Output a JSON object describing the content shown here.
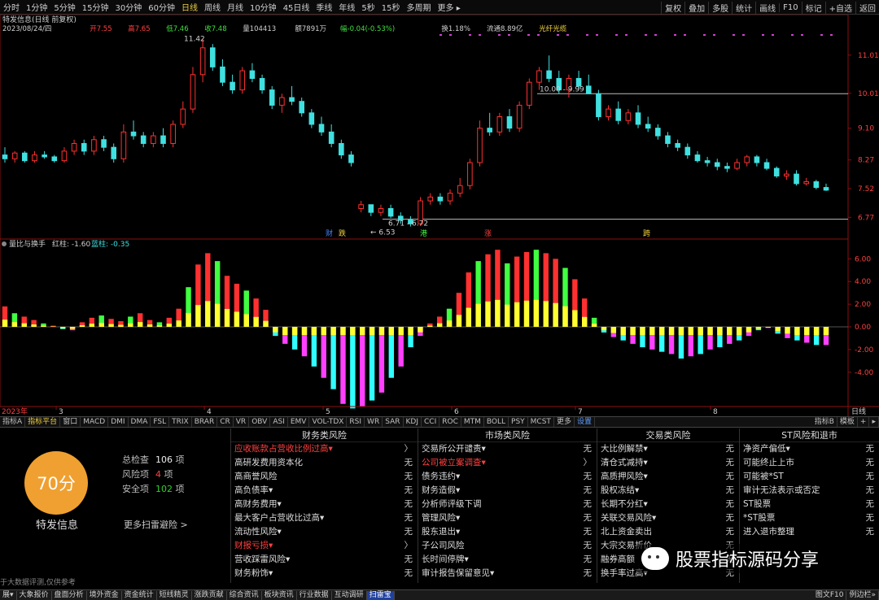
{
  "period_bar": {
    "items": [
      "分时",
      "1分钟",
      "5分钟",
      "15分钟",
      "30分钟",
      "60分钟",
      "日线",
      "周线",
      "月线",
      "10分钟",
      "45日线",
      "季线",
      "年线",
      "5秒",
      "15秒",
      "多周期",
      "更多 ▸"
    ],
    "active": "日线",
    "right": [
      "复权",
      "叠加",
      "多股",
      "统计",
      "画线",
      "F10",
      "标记",
      "+自选",
      "返回"
    ]
  },
  "stock_header": {
    "title": "特发信息(日线 前复权)",
    "date": "2023/08/24/四",
    "open": "开7.55",
    "high": "高7.65",
    "low": "低7.46",
    "close": "收7.48",
    "volume": "量104413",
    "amount": "额7891万",
    "change": "幅-0.04(-0.53%)",
    "turnover": "换1.18%",
    "float_value": "流通8.89亿",
    "concept": "光纤光缆"
  },
  "price_axis": [
    "11.01",
    "10.01",
    "9.10",
    "8.27",
    "7.52",
    "6.77"
  ],
  "price_annotations": {
    "high": "11.42",
    "mid_line": "10.00 - 9.99",
    "low": "6.71 - 6.72",
    "low_arrow": "← 6.53"
  },
  "signal_marks": [
    "财",
    "跌",
    "港",
    "涨",
    "跨"
  ],
  "indicator": {
    "name": "量比与换手",
    "red_label": "红柱: -1.60",
    "blue_label": "蓝柱: -0.35",
    "axis": [
      "6.00",
      "4.00",
      "2.00",
      "0.00",
      "-2.00",
      "-4.00"
    ]
  },
  "time_axis": [
    "2023年",
    "3",
    "4",
    "5",
    "6",
    "7",
    "8",
    "日线"
  ],
  "tab_bar": {
    "tabs": [
      "指标A",
      "指标平台",
      "窗口",
      "MACD",
      "DMI",
      "DMA",
      "FSL",
      "TRIX",
      "BRAR",
      "CR",
      "VR",
      "OBV",
      "ASI",
      "EMV",
      "VOL-TDX",
      "RSI",
      "WR",
      "SAR",
      "KDJ",
      "CCI",
      "ROC",
      "MTM",
      "BOLL",
      "PSY",
      "MCST",
      "更多",
      "设置"
    ],
    "right": [
      "指标B",
      "模板",
      "+",
      "▸"
    ]
  },
  "risk_panel": {
    "score": "70分",
    "company": "特发信息",
    "stats": [
      {
        "label": "总检查",
        "value": "106",
        "unit": "项"
      },
      {
        "label": "风险项",
        "value": "4",
        "unit": "项"
      },
      {
        "label": "安全项",
        "value": "102",
        "unit": "项"
      }
    ],
    "more": "更多扫雷避险 >",
    "disclaimer": "于大数据评测,仅供参考",
    "columns": [
      {
        "title": "财务类风险",
        "rows": [
          {
            "label": "应收账款占营收比例过高▾",
            "value": "〉",
            "risk": true
          },
          {
            "label": "高研发费用资本化",
            "value": "无",
            "risk": false
          },
          {
            "label": "高商誉风险",
            "value": "无",
            "risk": false
          },
          {
            "label": "高负债率▾",
            "value": "无",
            "risk": false
          },
          {
            "label": "高财务费用▾",
            "value": "无",
            "risk": false
          },
          {
            "label": "最大客户占营收比过高▾",
            "value": "无",
            "risk": false
          },
          {
            "label": "流动性风险▾",
            "value": "无",
            "risk": false
          },
          {
            "label": "财报亏损▾",
            "value": "〉",
            "risk": true
          },
          {
            "label": "营收踩雷风险▾",
            "value": "无",
            "risk": false
          },
          {
            "label": "财务粉饰▾",
            "value": "无",
            "risk": false
          }
        ]
      },
      {
        "title": "市场类风险",
        "rows": [
          {
            "label": "交易所公开谴责▾",
            "value": "无",
            "risk": false
          },
          {
            "label": "公司被立案调查▾",
            "value": "〉",
            "risk": true
          },
          {
            "label": "债务违约▾",
            "value": "无",
            "risk": false
          },
          {
            "label": "财务造假▾",
            "value": "无",
            "risk": false
          },
          {
            "label": "分析师评级下调",
            "value": "无",
            "risk": false
          },
          {
            "label": "管理风险▾",
            "value": "无",
            "risk": false
          },
          {
            "label": "股东退出▾",
            "value": "无",
            "risk": false
          },
          {
            "label": "子公司风险",
            "value": "无",
            "risk": false
          },
          {
            "label": "长时间停牌▾",
            "value": "无",
            "risk": false
          },
          {
            "label": "审计报告保留意见▾",
            "value": "无",
            "risk": false
          }
        ]
      },
      {
        "title": "交易类风险",
        "rows": [
          {
            "label": "大比例解禁▾",
            "value": "无",
            "risk": false
          },
          {
            "label": "清仓式减持▾",
            "value": "无",
            "risk": false
          },
          {
            "label": "高质押风险▾",
            "value": "无",
            "risk": false
          },
          {
            "label": "股权冻结▾",
            "value": "无",
            "risk": false
          },
          {
            "label": "长期不分红▾",
            "value": "无",
            "risk": false
          },
          {
            "label": "关联交易风险▾",
            "value": "无",
            "risk": false
          },
          {
            "label": "北上资金卖出",
            "value": "无",
            "risk": false
          },
          {
            "label": "大宗交易折价",
            "value": "无",
            "risk": false
          },
          {
            "label": "融券高额",
            "value": "无",
            "risk": false
          },
          {
            "label": "换手率过高▾",
            "value": "无",
            "risk": false
          }
        ]
      },
      {
        "title": "ST风险和退市",
        "rows": [
          {
            "label": "净资产偏低▾",
            "value": "无",
            "risk": false
          },
          {
            "label": "可能终止上市",
            "value": "无",
            "risk": false
          },
          {
            "label": "可能被*ST",
            "value": "无",
            "risk": false
          },
          {
            "label": "审计无法表示或否定",
            "value": "无",
            "risk": false
          },
          {
            "label": "ST股票",
            "value": "无",
            "risk": false
          },
          {
            "label": "*ST股票",
            "value": "无",
            "risk": false
          },
          {
            "label": "进入退市整理",
            "value": "无",
            "risk": false
          }
        ]
      }
    ]
  },
  "watermark": "股票指标源码分享",
  "status_bar": {
    "items": [
      "展▾",
      "大象报价",
      "盘面分析",
      "境外资金",
      "资金统计",
      "短线精灵",
      "涨跌贡献",
      "综合资讯",
      "板块资讯",
      "行业数据",
      "互动调研",
      "扫雷宝"
    ],
    "active": "扫雷宝",
    "right": [
      "图文F10",
      "例边栏»"
    ]
  },
  "colors": {
    "up": "#ff3030",
    "down": "#40e0e0",
    "yellow": "#ffff30",
    "magenta": "#ff40ff",
    "green": "#40ff40",
    "cyan": "#30ffff",
    "score_bg": "#f0a030"
  },
  "chart_data": {
    "type": "candlestick",
    "title": "特发信息(日线 前复权)",
    "x_months": [
      "2023年",
      "3",
      "4",
      "5",
      "6",
      "7",
      "8"
    ],
    "y_ticks": [
      11.01,
      10.01,
      9.1,
      8.27,
      7.52,
      6.77
    ],
    "ylim": [
      6.5,
      11.6
    ],
    "candles": [
      [
        8.4,
        8.6,
        8.2,
        8.3
      ],
      [
        8.3,
        8.5,
        8.2,
        8.45
      ],
      [
        8.45,
        8.5,
        8.2,
        8.25
      ],
      [
        8.25,
        8.5,
        8.2,
        8.4
      ],
      [
        8.4,
        8.5,
        8.3,
        8.35
      ],
      [
        8.35,
        8.4,
        8.2,
        8.25
      ],
      [
        8.25,
        8.6,
        8.2,
        8.5
      ],
      [
        8.5,
        8.8,
        8.4,
        8.7
      ],
      [
        8.7,
        8.8,
        8.4,
        8.5
      ],
      [
        8.5,
        8.9,
        8.4,
        8.8
      ],
      [
        8.8,
        8.9,
        8.5,
        8.6
      ],
      [
        8.6,
        8.7,
        8.2,
        8.3
      ],
      [
        8.3,
        9.2,
        8.2,
        9.0
      ],
      [
        9.0,
        9.3,
        8.8,
        8.9
      ],
      [
        8.9,
        9.0,
        8.6,
        8.7
      ],
      [
        8.7,
        9.0,
        8.6,
        8.9
      ],
      [
        8.9,
        9.1,
        8.6,
        8.7
      ],
      [
        8.7,
        9.3,
        8.6,
        9.2
      ],
      [
        9.2,
        9.8,
        9.1,
        9.6
      ],
      [
        9.6,
        10.7,
        9.5,
        10.5
      ],
      [
        10.5,
        11.42,
        10.3,
        11.2
      ],
      [
        11.2,
        11.3,
        10.6,
        10.7
      ],
      [
        10.7,
        10.9,
        10.2,
        10.3
      ],
      [
        10.3,
        10.5,
        10.0,
        10.1
      ],
      [
        10.1,
        10.7,
        10.0,
        10.6
      ],
      [
        10.6,
        10.8,
        10.3,
        10.4
      ],
      [
        10.4,
        10.5,
        10.0,
        10.1
      ],
      [
        10.1,
        10.2,
        9.6,
        9.7
      ],
      [
        9.7,
        10.0,
        9.5,
        9.9
      ],
      [
        9.9,
        10.2,
        9.7,
        9.8
      ],
      [
        9.8,
        9.9,
        9.4,
        9.5
      ],
      [
        9.5,
        9.6,
        9.1,
        9.2
      ],
      [
        9.2,
        9.4,
        8.9,
        9.0
      ],
      [
        9.0,
        9.2,
        8.6,
        8.7
      ],
      [
        8.7,
        8.8,
        8.3,
        8.4
      ],
      [
        8.4,
        8.5,
        8.1,
        8.2
      ],
      [
        7.0,
        7.2,
        6.9,
        7.1
      ],
      [
        7.1,
        7.1,
        6.8,
        6.9
      ],
      [
        6.9,
        7.1,
        6.8,
        7.0
      ],
      [
        7.0,
        7.1,
        6.75,
        6.8
      ],
      [
        6.8,
        6.9,
        6.6,
        6.7
      ],
      [
        6.7,
        6.8,
        6.53,
        6.6
      ],
      [
        6.6,
        7.3,
        6.55,
        7.2
      ],
      [
        7.2,
        7.4,
        7.1,
        7.3
      ],
      [
        7.3,
        7.4,
        7.1,
        7.2
      ],
      [
        7.2,
        7.5,
        7.1,
        7.4
      ],
      [
        7.4,
        7.8,
        7.3,
        7.6
      ],
      [
        7.6,
        8.3,
        7.5,
        8.2
      ],
      [
        8.2,
        9.3,
        8.1,
        9.1
      ],
      [
        9.1,
        9.5,
        8.9,
        9.0
      ],
      [
        9.0,
        9.5,
        8.9,
        9.4
      ],
      [
        9.4,
        9.6,
        9.0,
        9.1
      ],
      [
        9.1,
        9.8,
        9.0,
        9.7
      ],
      [
        9.7,
        10.4,
        9.6,
        10.3
      ],
      [
        10.3,
        10.7,
        10.1,
        10.6
      ],
      [
        10.6,
        11.0,
        10.3,
        10.4
      ],
      [
        10.4,
        10.6,
        10.0,
        10.1
      ],
      [
        10.1,
        10.5,
        9.9,
        10.4
      ],
      [
        10.4,
        10.6,
        10.1,
        10.2
      ],
      [
        10.2,
        10.5,
        9.99,
        10.0
      ],
      [
        10.0,
        10.1,
        9.3,
        9.4
      ],
      [
        9.4,
        9.7,
        9.3,
        9.6
      ],
      [
        9.6,
        9.8,
        9.2,
        9.3
      ],
      [
        9.3,
        9.6,
        9.2,
        9.5
      ],
      [
        9.5,
        9.7,
        9.1,
        9.2
      ],
      [
        9.2,
        9.4,
        9.0,
        9.1
      ],
      [
        9.1,
        9.2,
        8.8,
        8.9
      ],
      [
        8.9,
        9.0,
        8.6,
        8.7
      ],
      [
        8.7,
        8.8,
        8.5,
        8.6
      ],
      [
        8.6,
        8.7,
        8.3,
        8.4
      ],
      [
        8.4,
        8.5,
        8.2,
        8.25
      ],
      [
        8.25,
        8.35,
        8.1,
        8.2
      ],
      [
        8.2,
        8.3,
        8.0,
        8.1
      ],
      [
        8.1,
        8.2,
        7.95,
        8.05
      ],
      [
        8.05,
        8.3,
        8.0,
        8.2
      ],
      [
        8.2,
        8.4,
        8.1,
        8.35
      ],
      [
        8.35,
        8.4,
        8.1,
        8.2
      ],
      [
        8.2,
        8.3,
        8.0,
        8.05
      ],
      [
        8.05,
        8.1,
        7.8,
        7.85
      ],
      [
        7.85,
        8.0,
        7.75,
        7.9
      ],
      [
        7.9,
        8.0,
        7.6,
        7.65
      ],
      [
        7.65,
        7.8,
        7.6,
        7.7
      ],
      [
        7.7,
        7.75,
        7.5,
        7.55
      ],
      [
        7.55,
        7.65,
        7.46,
        7.48
      ]
    ],
    "indicator_bars": [
      1.8,
      1.2,
      0.9,
      0.6,
      0.3,
      0.1,
      -0.2,
      -0.3,
      0.4,
      0.8,
      1.0,
      0.7,
      0.5,
      0.9,
      1.2,
      0.6,
      0.4,
      0.8,
      1.6,
      3.5,
      5.5,
      6.5,
      5.8,
      4.5,
      3.8,
      3.2,
      2.5,
      1.5,
      -0.8,
      -1.5,
      -2.0,
      -2.6,
      -3.5,
      -4.5,
      -5.5,
      -6.8,
      -7.2,
      -7.0,
      -6.5,
      -5.8,
      -4.5,
      -3.5,
      -1.8,
      -0.8,
      0.3,
      0.9,
      1.6,
      3.0,
      4.8,
      5.8,
      6.4,
      6.8,
      5.6,
      6.2,
      6.6,
      6.8,
      6.5,
      6.0,
      5.2,
      4.2,
      2.5,
      0.8,
      -0.5,
      -0.9,
      -1.2,
      -1.5,
      -1.8,
      -2.0,
      -2.2,
      -2.4,
      -2.8,
      -2.6,
      -2.4,
      -2.0,
      -1.8,
      -1.5,
      -1.2,
      -0.8,
      -0.3,
      -0.1,
      -0.6,
      -1.0,
      -1.2,
      -1.4,
      -1.6,
      -1.6
    ]
  }
}
